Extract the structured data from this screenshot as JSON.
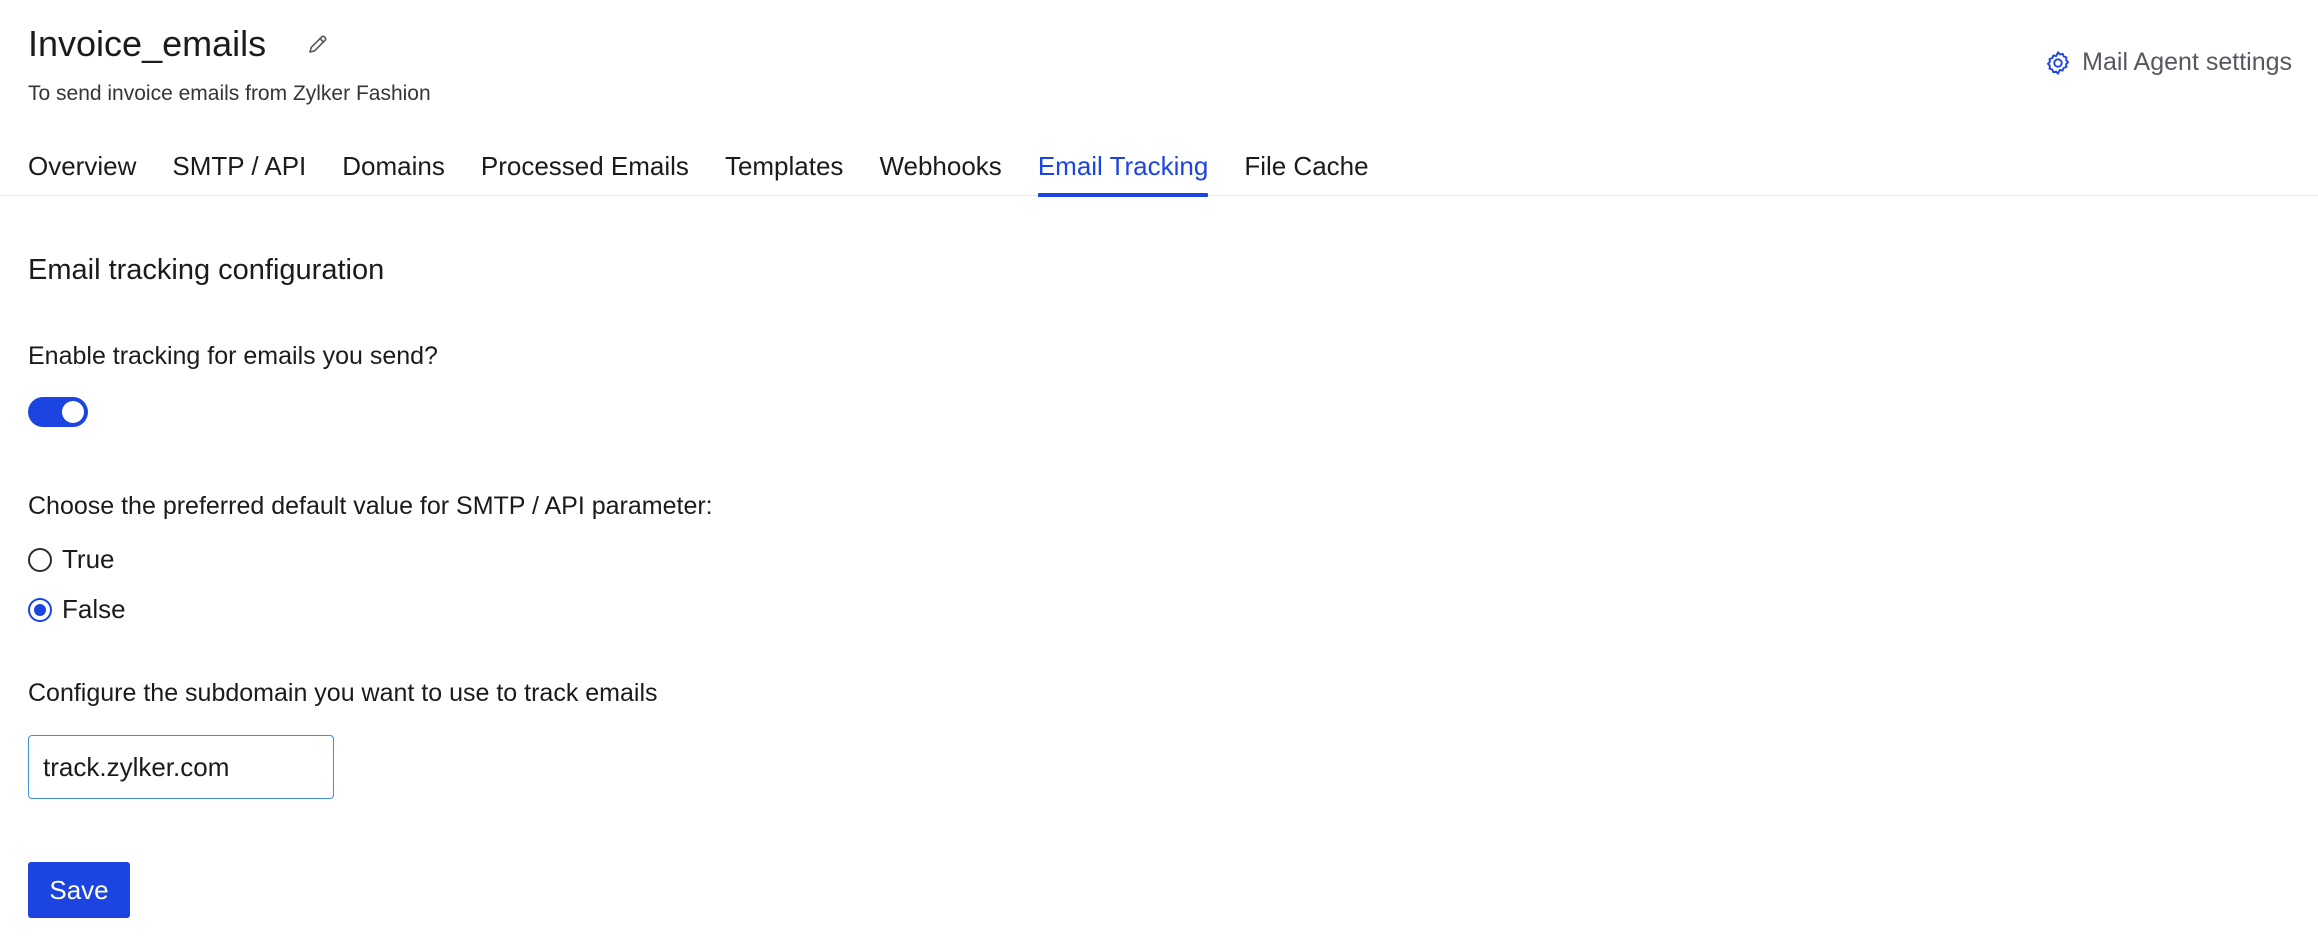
{
  "header": {
    "title": "Invoice_emails",
    "subtitle": "To send invoice emails from Zylker Fashion",
    "edit_icon": "pencil-icon",
    "settings_label": "Mail Agent settings",
    "settings_icon": "gear-icon"
  },
  "tabs": [
    {
      "label": "Overview",
      "active": false
    },
    {
      "label": "SMTP / API",
      "active": false
    },
    {
      "label": "Domains",
      "active": false
    },
    {
      "label": "Processed Emails",
      "active": false
    },
    {
      "label": "Templates",
      "active": false
    },
    {
      "label": "Webhooks",
      "active": false
    },
    {
      "label": "Email Tracking",
      "active": true
    },
    {
      "label": "File Cache",
      "active": false
    }
  ],
  "main": {
    "section_title": "Email tracking configuration",
    "tracking_question": "Enable tracking for emails you send?",
    "tracking_enabled": true,
    "default_value_question": "Choose the preferred default value for SMTP / API parameter:",
    "options": [
      {
        "label": "True",
        "selected": false
      },
      {
        "label": "False",
        "selected": true
      }
    ],
    "subdomain_question": "Configure the subdomain you want to use to track emails",
    "subdomain_value": "track.zylker.com",
    "save_label": "Save"
  },
  "colors": {
    "accent": "#1c44e0",
    "input_border": "#3f8fd9",
    "text": "#1b1b1f",
    "muted": "#55585f"
  }
}
